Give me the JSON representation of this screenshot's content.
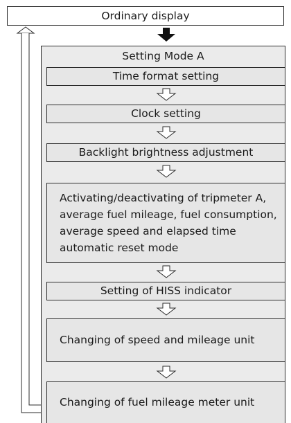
{
  "top": {
    "label": "Ordinary display"
  },
  "mode": {
    "title": "Setting Mode A"
  },
  "steps": [
    {
      "label": "Time format setting"
    },
    {
      "label": "Clock setting"
    },
    {
      "label": "Backlight brightness adjustment"
    },
    {
      "label": "Activating/deactivating of tripmeter A, average fuel mileage, fuel consumption, average speed and elapsed time automatic reset mode"
    },
    {
      "label": "Setting of HISS indicator"
    },
    {
      "label": "Changing of speed and mileage unit"
    },
    {
      "label": "Changing of fuel mileage meter unit"
    }
  ],
  "colors": {
    "panel": "#ebebeb",
    "step": "#e6e6e6",
    "line": "#2b2b2b"
  }
}
